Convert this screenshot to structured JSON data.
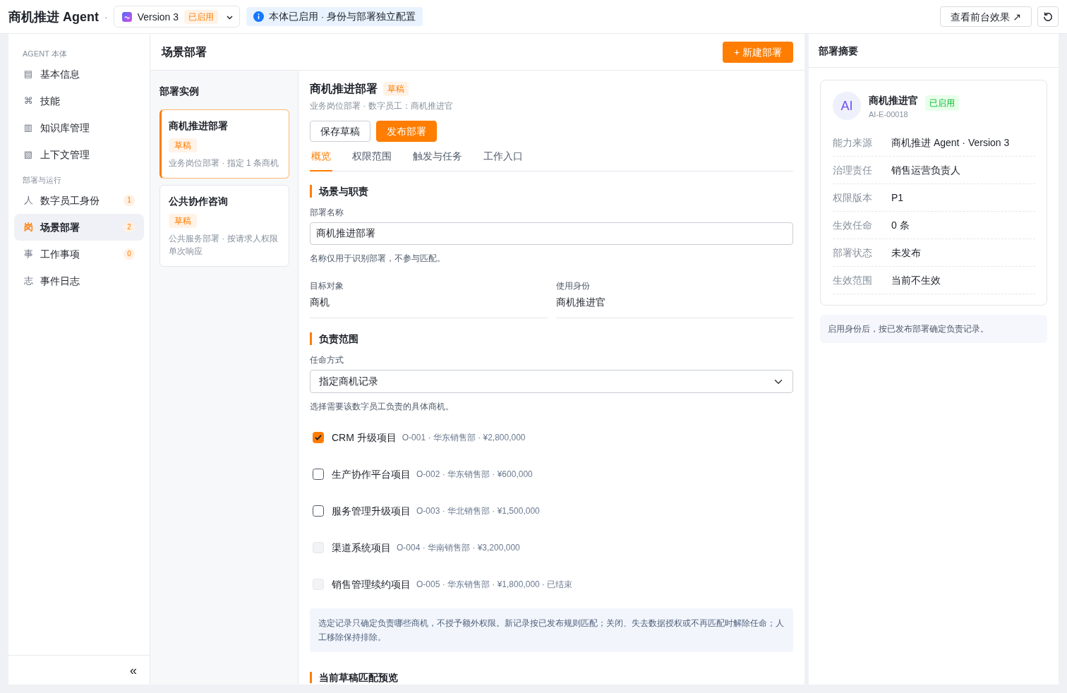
{
  "header": {
    "title": "商机推进 Agent",
    "separator": "·",
    "version": {
      "label": "Version 3",
      "status": "已启用"
    },
    "notice": "本体已启用 · 身份与部署独立配置",
    "preview_button": "查看前台效果 ↗"
  },
  "sidebar": {
    "groups": [
      {
        "title": "AGENT 本体",
        "items": [
          {
            "icon": "▤",
            "label": "基本信息",
            "selected": false
          },
          {
            "icon": "⌘",
            "label": "技能",
            "selected": false
          },
          {
            "icon": "▥",
            "label": "知识库管理",
            "selected": false
          },
          {
            "icon": "▧",
            "label": "上下文管理",
            "selected": false
          }
        ]
      },
      {
        "title": "部署与运行",
        "items": [
          {
            "icon": "人",
            "label": "数字员工身份",
            "count": "1",
            "selected": false
          },
          {
            "icon": "岗",
            "label": "场景部署",
            "count": "2",
            "selected": true
          },
          {
            "icon": "事",
            "label": "工作事项",
            "count": "0",
            "selected": false
          },
          {
            "icon": "志",
            "label": "事件日志",
            "selected": false
          }
        ]
      }
    ],
    "collapse": "«"
  },
  "deployments": {
    "title": "场景部署",
    "new_button": "+ 新建部署",
    "list_title": "部署实例",
    "items": [
      {
        "name": "商机推进部署",
        "status": "草稿",
        "description": "业务岗位部署 · 指定 1 条商机",
        "selected": true
      },
      {
        "name": "公共协作咨询",
        "status": "草稿",
        "description": "公共服务部署 · 按请求人权限单次响应",
        "selected": false
      }
    ]
  },
  "detail": {
    "title": "商机推进部署",
    "status": "草稿",
    "subtitle": "业务岗位部署 · 数字员工：商机推进官",
    "actions": [
      {
        "label": "保存草稿",
        "kind": "secondary"
      },
      {
        "label": "发布部署",
        "kind": "primary"
      }
    ],
    "tabs": [
      {
        "label": "概览",
        "selected": true
      },
      {
        "label": "权限范围",
        "selected": false
      },
      {
        "label": "触发与任务",
        "selected": false
      },
      {
        "label": "工作入口",
        "selected": false
      }
    ],
    "scene": {
      "title": "场景与职责",
      "name_label": "部署名称",
      "name_value": "商机推进部署",
      "name_help": "名称仅用于识别部署，不参与匹配。",
      "fields": [
        {
          "label": "目标对象",
          "value": "商机"
        },
        {
          "label": "使用身份",
          "value": "商机推进官"
        }
      ]
    },
    "scope": {
      "title": "负责范围",
      "mode_label": "任命方式",
      "mode_value": "指定商机记录",
      "mode_help": "选择需要该数字员工负责的具体商机。",
      "records": [
        {
          "name": "CRM 升级项目",
          "meta": "O-001 · 华东销售部 · ¥2,800,000",
          "checked": true,
          "disabled": false
        },
        {
          "name": "生产协作平台项目",
          "meta": "O-002 · 华东销售部 · ¥600,000",
          "checked": false,
          "disabled": false
        },
        {
          "name": "服务管理升级项目",
          "meta": "O-003 · 华北销售部 · ¥1,500,000",
          "checked": false,
          "disabled": false
        },
        {
          "name": "渠道系统项目",
          "meta": "O-004 · 华南销售部 · ¥3,200,000",
          "checked": false,
          "disabled": true
        },
        {
          "name": "销售管理续约项目",
          "meta": "O-005 · 华东销售部 · ¥1,800,000 · 已结束",
          "checked": false,
          "disabled": true
        }
      ],
      "note": "选定记录只确定负责哪些商机，不授予额外权限。新记录按已发布规则匹配；关闭、失去数据授权或不再匹配时解除任命；人工移除保持排除。"
    },
    "preview": {
      "title": "当前草稿匹配预览"
    }
  },
  "summary": {
    "title": "部署摘要",
    "identity": {
      "avatar": "AI",
      "name": "商机推进官",
      "code": "AI-E-00018",
      "status": "已启用"
    },
    "rows": [
      {
        "label": "能力来源",
        "value": "商机推进 Agent · Version 3"
      },
      {
        "label": "治理责任",
        "value": "销售运营负责人"
      },
      {
        "label": "权限版本",
        "value": "P1"
      },
      {
        "label": "生效任命",
        "value": "0 条"
      },
      {
        "label": "部署状态",
        "value": "未发布"
      },
      {
        "label": "生效范围",
        "value": "当前不生效"
      }
    ],
    "note": "启用身份后，按已发布部署确定负责记录。"
  }
}
